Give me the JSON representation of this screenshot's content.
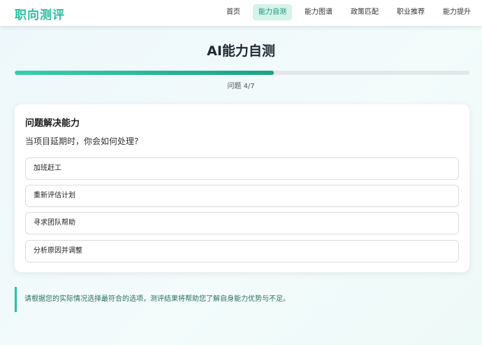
{
  "header": {
    "logo": "职向测评",
    "nav": [
      {
        "label": "首页",
        "active": false
      },
      {
        "label": "能力自测",
        "active": true
      },
      {
        "label": "能力图谱",
        "active": false
      },
      {
        "label": "政策匹配",
        "active": false
      },
      {
        "label": "职业推荐",
        "active": false
      },
      {
        "label": "能力提升",
        "active": false
      }
    ]
  },
  "main": {
    "title": "AI能力自测",
    "progress": {
      "value": 0.57,
      "text": "问题 4/7"
    },
    "question": {
      "category": "问题解决能力",
      "text": "当项目延期时，你会如何处理?",
      "options": [
        "加班赶工",
        "重新评估计划",
        "寻求团队帮助",
        "分析原因并调整"
      ]
    },
    "tip": "请根据您的实际情况选择最符合的选项，测评结果将帮助您了解自身能力优势与不足。"
  },
  "colors": {
    "accent": "#2bbf9f",
    "nav_active_bg": "#d4f3ea",
    "progress_start": "#36cfae",
    "progress_end": "#1aa37f"
  }
}
